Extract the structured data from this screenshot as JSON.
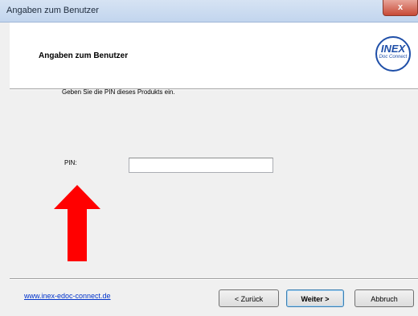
{
  "window": {
    "title": "Angaben zum Benutzer",
    "close_label": "x"
  },
  "header": {
    "title": "Angaben zum Benutzer",
    "logo_text": "INEX",
    "logo_subtext": "Doc Connect"
  },
  "main": {
    "instruction": "Geben Sie die PIN dieses Produkts ein.",
    "pin_label": "PIN:",
    "pin_value": ""
  },
  "footer": {
    "link": "www.inex-edoc-connect.de",
    "back_label": "< Zurück",
    "next_label": "Weiter >",
    "cancel_label": "Abbruch"
  },
  "annotation": {
    "arrow_color": "#ff0000"
  }
}
